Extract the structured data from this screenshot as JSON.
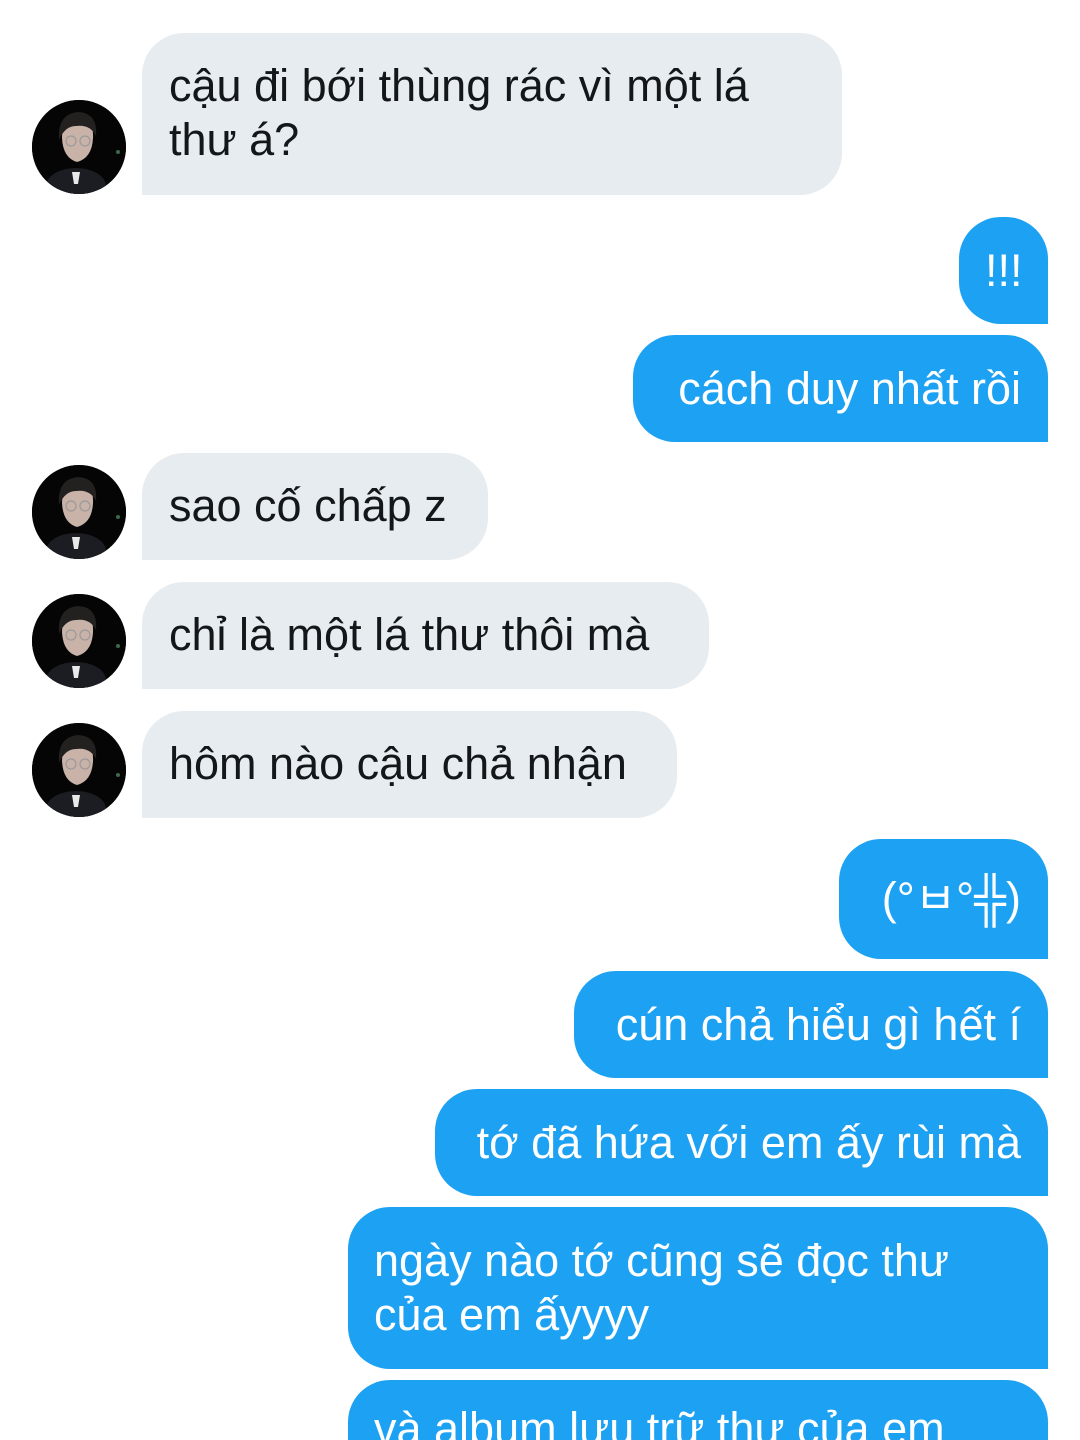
{
  "conversation": {
    "messages": [
      {
        "sender": "them",
        "text": "cậu đi bới thùng rác vì một lá thư á?"
      },
      {
        "sender": "me",
        "text": "!!!"
      },
      {
        "sender": "me",
        "text": "cách duy nhất rồi"
      },
      {
        "sender": "them",
        "text": "sao cố chấp z"
      },
      {
        "sender": "them",
        "text": "chỉ là một lá thư thôi mà"
      },
      {
        "sender": "them",
        "text": "hôm nào cậu chả nhận"
      },
      {
        "sender": "me",
        "text": "(°ㅂ°╬)"
      },
      {
        "sender": "me",
        "text": "cún chả hiểu gì hết í"
      },
      {
        "sender": "me",
        "text": "tớ đã hứa với em ấy rùi mà"
      },
      {
        "sender": "me",
        "text": "ngày nào tớ cũng sẽ đọc thư của em ấyyyy"
      },
      {
        "sender": "me",
        "text": "và album lưu trữ thư của em"
      }
    ]
  },
  "colors": {
    "incoming_bubble": "#e6ecf0",
    "incoming_text": "#14171a",
    "outgoing_bubble": "#1da1f2",
    "outgoing_text": "#ffffff",
    "background": "#ffffff",
    "avatar_background": "#050505"
  },
  "icons": {
    "avatar": "user-avatar-photo"
  }
}
